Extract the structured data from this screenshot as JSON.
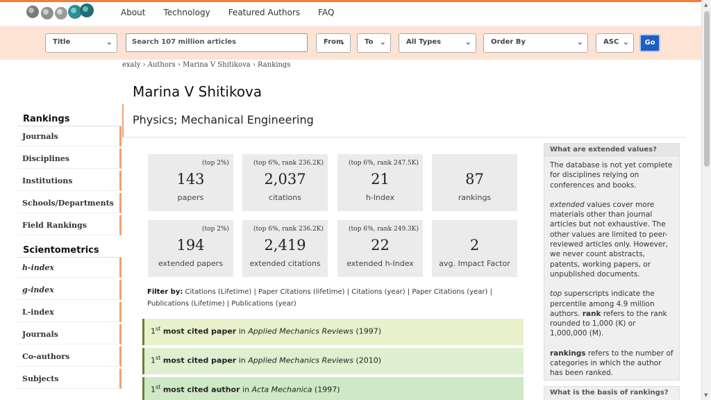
{
  "brand": {
    "accent": "#f47b3c",
    "searchbar_bg": "#fde3d3",
    "go_color": "#1f5fbf"
  },
  "nav": {
    "items": [
      "About",
      "Technology",
      "Featured Authors",
      "FAQ"
    ]
  },
  "search": {
    "field_select": "Title",
    "placeholder": "Search 107 million articles",
    "from": "From",
    "to": "To",
    "types": "All Types",
    "order_by": "Order By",
    "direction": "ASC",
    "go": "Go"
  },
  "breadcrumb": "exaly › Authors › Marina V Shitikova › Rankings",
  "author": {
    "name": "Marina V Shitikova",
    "disciplines": "Physics; Mechanical Engineering"
  },
  "sidebar": {
    "rankings_heading": "Rankings",
    "rankings_items": [
      "Journals",
      "Disciplines",
      "Institutions",
      "Schools/Departments",
      "Field Rankings"
    ],
    "scientometrics_heading": "Scientometrics",
    "scientometrics_items": [
      "h-index",
      "g-index",
      "L-index",
      "Journals",
      "Co-authors",
      "Subjects"
    ]
  },
  "stats": [
    {
      "sup": "(top 2%)",
      "value": "143",
      "label": "papers"
    },
    {
      "sup": "(top 6%, rank 236.2K)",
      "value": "2,037",
      "label": "citations"
    },
    {
      "sup": "(top 6%, rank 247.5K)",
      "value": "21",
      "label": "h-Index"
    },
    {
      "sup": "",
      "value": "87",
      "label": "rankings"
    },
    {
      "sup": "(top 2%)",
      "value": "194",
      "label": "extended papers"
    },
    {
      "sup": "(top 6%, rank 236.2K)",
      "value": "2,419",
      "label": "extended citations"
    },
    {
      "sup": "(top 6%, rank 249.3K)",
      "value": "22",
      "label": "extended h-Index"
    },
    {
      "sup": "",
      "value": "2",
      "label": "avg. Impact Factor"
    }
  ],
  "filter": {
    "label": "Filter by:",
    "text": "Citations (Lifetime) | Paper Citations (lifetime) | Citations (year) | Paper Citations (year) | Publications (Lifetime) | Publications (year)"
  },
  "rank_rows": [
    {
      "ord": "1",
      "sup": "st",
      "what": "most cited paper",
      "in": "in",
      "venue": "Applied Mechanics Reviews",
      "year": "(1997)",
      "bg": "#e9f1cb"
    },
    {
      "ord": "1",
      "sup": "st",
      "what": "most cited paper",
      "in": "in",
      "venue": "Applied Mechanics Reviews",
      "year": "(2010)",
      "bg": "#def0cf"
    },
    {
      "ord": "1",
      "sup": "st",
      "what": "most cited author",
      "in": "in",
      "venue": "Acta Mechanica",
      "year": "(1997)",
      "bg": "#cfe8c6"
    }
  ],
  "info": {
    "heading": "What are extended values?",
    "p1": "The database is not yet complete for disciplines relying on conferences and books.",
    "p2_em": "extended",
    "p2": " values cover more materials other than journal articles but not exhaustive. The other values are limited to peer-reviewed articles only. However, we never count abstracts, patents, working papers, or unpublished documents.",
    "p3_em": "top",
    "p3a": " superscripts indicate the percentile among 4.9 million authors. ",
    "p3_b": "rank",
    "p3b": " refers to the rank rounded to 1,000 (K) or 1,000,000 (M).",
    "p4_b": "rankings",
    "p4": " refers to the number of categories in which the author has been ranked.",
    "heading2": "What is the basis of rankings?"
  }
}
